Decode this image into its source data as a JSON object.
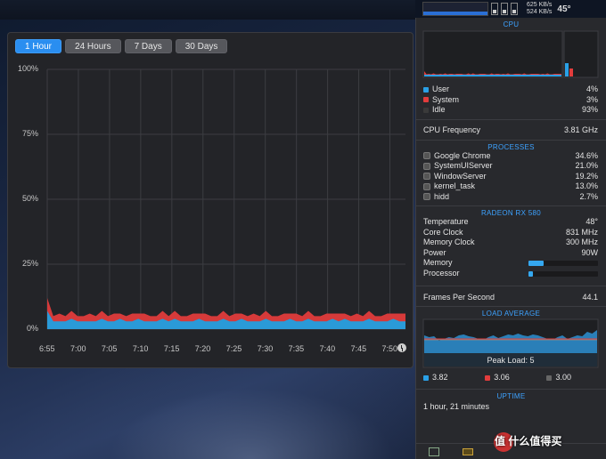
{
  "history": {
    "tabs": [
      "1 Hour",
      "24 Hours",
      "7 Days",
      "30 Days"
    ],
    "active_tab": 0,
    "y_labels": [
      "100%",
      "75%",
      "50%",
      "25%",
      "0%"
    ],
    "x_labels": [
      "6:55",
      "7:00",
      "7:05",
      "7:10",
      "7:15",
      "7:20",
      "7:25",
      "7:30",
      "7:35",
      "7:40",
      "7:45",
      "7:50"
    ]
  },
  "chart_data": {
    "type": "area",
    "title": "",
    "ylim": [
      0,
      100
    ],
    "series": [
      {
        "name": "User",
        "color": "#2a9ad8",
        "values": [
          7,
          3,
          3,
          3,
          4,
          3,
          3,
          3,
          3,
          4,
          3,
          3,
          4,
          3,
          3,
          4,
          3,
          3,
          3,
          4,
          3,
          4,
          3,
          3,
          3,
          4,
          3,
          3,
          3,
          4,
          3,
          3,
          4,
          3,
          3,
          3,
          4,
          3,
          3,
          3,
          4,
          3,
          3,
          4,
          3,
          3,
          3,
          4,
          3,
          4,
          3,
          3,
          3,
          4,
          3,
          3,
          3,
          4,
          3,
          3
        ]
      },
      {
        "name": "System",
        "color": "#d63a3a",
        "values": [
          5,
          2,
          3,
          2,
          3,
          2,
          2,
          3,
          2,
          3,
          2,
          3,
          2,
          2,
          3,
          2,
          3,
          2,
          2,
          3,
          2,
          3,
          2,
          2,
          3,
          2,
          3,
          2,
          2,
          3,
          2,
          3,
          2,
          2,
          3,
          2,
          3,
          2,
          2,
          3,
          2,
          3,
          2,
          3,
          2,
          2,
          3,
          2,
          3,
          2,
          2,
          3,
          2,
          3,
          2,
          2,
          3,
          2,
          3,
          3
        ]
      }
    ]
  },
  "statusbar": {
    "cpu_label": "CPU",
    "net_up": "625 KB/s",
    "net_down": "524 KB/s",
    "temp": "45°"
  },
  "cpu": {
    "title": "CPU",
    "user_label": "User",
    "user_value": "4%",
    "system_label": "System",
    "system_value": "3%",
    "idle_label": "Idle",
    "idle_value": "93%",
    "freq_label": "CPU Frequency",
    "freq_value": "3.81 GHz",
    "colors": {
      "user": "#2aa0e6",
      "system": "#e23c3c",
      "idle": "#444"
    }
  },
  "processes": {
    "title": "PROCESSES",
    "items": [
      {
        "name": "Google Chrome",
        "value": "34.6%"
      },
      {
        "name": "SystemUIServer",
        "value": "21.0%"
      },
      {
        "name": "WindowServer",
        "value": "19.2%"
      },
      {
        "name": "kernel_task",
        "value": "13.0%"
      },
      {
        "name": "hidd",
        "value": "2.7%"
      }
    ]
  },
  "gpu": {
    "title": "RADEON RX 580",
    "temperature_label": "Temperature",
    "temperature_value": "48°",
    "core_label": "Core Clock",
    "core_value": "831 MHz",
    "mem_clock_label": "Memory Clock",
    "mem_clock_value": "300 MHz",
    "power_label": "Power",
    "power_value": "90W",
    "memory_label": "Memory",
    "memory_fill": 0.22,
    "processor_label": "Processor",
    "processor_fill": 0.06,
    "fps_label": "Frames Per Second",
    "fps_value": "44.1"
  },
  "load": {
    "title": "LOAD AVERAGE",
    "peak_label": "Peak Load: 5",
    "v1": "3.82",
    "v2": "3.06",
    "v3": "3.00"
  },
  "uptime": {
    "title": "UPTIME",
    "value": "1 hour, 21 minutes"
  },
  "watermark": "值 什么值得买"
}
